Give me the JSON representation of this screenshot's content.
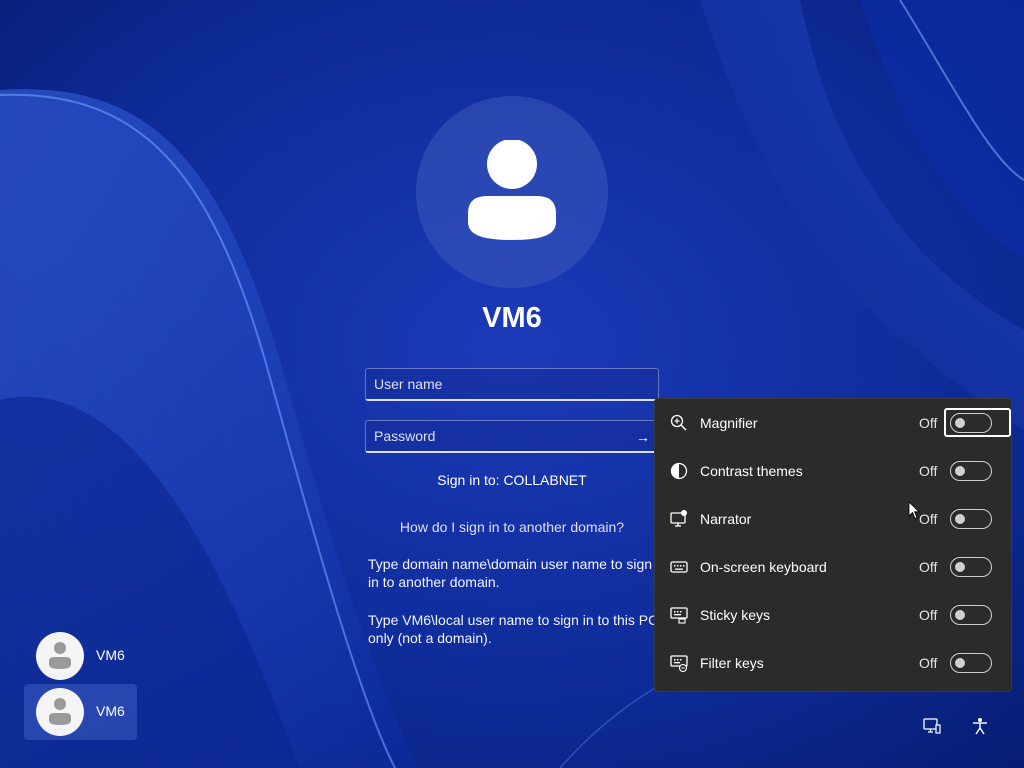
{
  "user": {
    "title": "VM6"
  },
  "login": {
    "username_placeholder": "User name",
    "password_placeholder": "Password",
    "sign_in_to": "Sign in to: COLLABNET",
    "domain_link": "How do I sign in to another domain?",
    "help_line_1": "Type domain name\\domain user name to sign\nin to another domain.",
    "help_line_2": "Type VM6\\local user name to sign in to this PC\nonly (not a domain)."
  },
  "user_tiles": [
    {
      "name": "VM6",
      "selected": false
    },
    {
      "name": "VM6",
      "selected": true
    }
  ],
  "accessibility": {
    "items": [
      {
        "label": "Magnifier",
        "state": "Off",
        "icon": "magnifier-icon"
      },
      {
        "label": "Contrast themes",
        "state": "Off",
        "icon": "contrast-icon"
      },
      {
        "label": "Narrator",
        "state": "Off",
        "icon": "narrator-icon"
      },
      {
        "label": "On-screen keyboard",
        "state": "Off",
        "icon": "keyboard-icon"
      },
      {
        "label": "Sticky keys",
        "state": "Off",
        "icon": "sticky-keys-icon"
      },
      {
        "label": "Filter keys",
        "state": "Off",
        "icon": "filter-keys-icon"
      }
    ]
  },
  "corner_icons": [
    "network-icon",
    "accessibility-icon"
  ],
  "colors": {
    "panel_bg": "#2b2b2b",
    "wallpaper": "#0a2a8a"
  }
}
